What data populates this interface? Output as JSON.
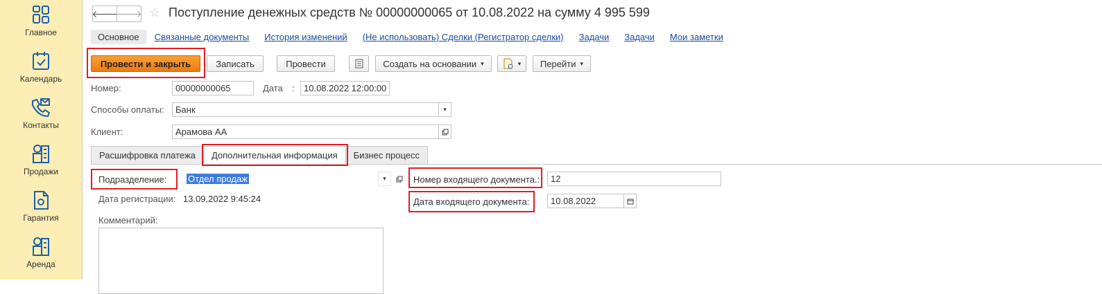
{
  "sidebar": {
    "items": [
      {
        "label": "Главное",
        "icon": "home-grid-icon"
      },
      {
        "label": "Календарь",
        "icon": "calendar-icon"
      },
      {
        "label": "Контакты",
        "icon": "contacts-icon"
      },
      {
        "label": "Продажи",
        "icon": "sales-building-icon"
      },
      {
        "label": "Гарантия",
        "icon": "warranty-document-icon"
      },
      {
        "label": "Аренда",
        "icon": "rent-building-icon"
      }
    ]
  },
  "header": {
    "title": "Поступление денежных средств № 00000000065 от 10.08.2022 на сумму 4 995 599",
    "back_glyph": "🡐",
    "forward_glyph": "🡒",
    "star_glyph": "☆"
  },
  "section_tabs": [
    {
      "label": "Основное",
      "active": true
    },
    {
      "label": "Связанные документы",
      "active": false
    },
    {
      "label": "История изменений",
      "active": false
    },
    {
      "label": "(Не использовать) Сделки (Регистратор сделки)",
      "active": false
    },
    {
      "label": "Задачи",
      "active": false
    },
    {
      "label": "Задачи",
      "active": false
    },
    {
      "label": "Мои заметки",
      "active": false
    }
  ],
  "toolbar": {
    "post_and_close": "Провести и закрыть",
    "save": "Записать",
    "post": "Провести",
    "create_based_on": "Создать на основании",
    "go_to": "Перейти",
    "caret": "▾"
  },
  "form": {
    "number_label": "Номер:",
    "number_value": "00000000065",
    "date_label": "Дата",
    "date_colon": ":",
    "date_value": "10.08.2022 12:00:00",
    "payment_label": "Способы оплаты:",
    "payment_value": "Банк",
    "client_label": "Клиент:",
    "client_value": "Арамова АА"
  },
  "panel_tabs": [
    {
      "label": "Расшифровка платежа",
      "active": false
    },
    {
      "label": "Дополнительная информация",
      "active": true
    },
    {
      "label": "Бизнес процесс",
      "active": false
    }
  ],
  "additional": {
    "division_label": "Подразделение:",
    "division_value": "Отдел продаж",
    "reg_date_label": "Дата регистрации:",
    "reg_date_value": "13.09.2022 9:45:24",
    "comment_label": "Комментарий:",
    "incoming_number_label": "Номер входящего документа.:",
    "incoming_number_value": "12",
    "incoming_date_label": "Дата входящего документа:",
    "incoming_date_value": "10.08.2022"
  },
  "colors": {
    "sidebar_bg": "#fbedb4",
    "primary_button": "#ec7b12",
    "highlight": "#e41b23",
    "link": "#1c4aa1"
  }
}
